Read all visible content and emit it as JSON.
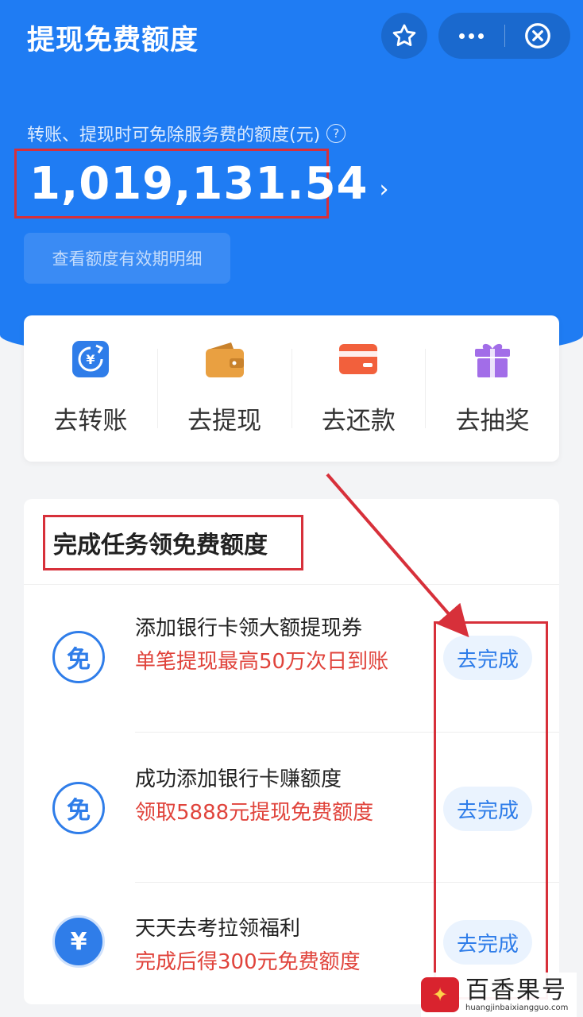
{
  "header": {
    "title": "提现免费额度"
  },
  "quota": {
    "label": "转账、提现时可免除服务费的额度(元)",
    "help": "?",
    "amount": "1,019,131.54",
    "arrow": "›",
    "validity_button": "查看额度有效期明细"
  },
  "actions": [
    {
      "label": "去转账",
      "icon": "transfer-icon",
      "color": "#2f7de9"
    },
    {
      "label": "去提现",
      "icon": "wallet-icon",
      "color": "#e9a041"
    },
    {
      "label": "去还款",
      "icon": "card-icon",
      "color": "#f2603c"
    },
    {
      "label": "去抽奖",
      "icon": "gift-icon",
      "color": "#a26de8"
    }
  ],
  "tasks": {
    "title": "完成任务领免费额度",
    "items": [
      {
        "icon": "免",
        "title": "添加银行卡领大额提现券",
        "desc": "单笔提现最高50万次日到账",
        "button": "去完成"
      },
      {
        "icon": "免",
        "title": "成功添加银行卡赚额度",
        "desc": "领取5888元提现免费额度",
        "button": "去完成"
      },
      {
        "icon": "¥",
        "title": "天天去考拉领福利",
        "desc": "完成后得300元免费额度",
        "button": "去完成"
      }
    ]
  },
  "watermark": {
    "name": "百香果号",
    "url": "huangjinbaixiangguo.com"
  },
  "colors": {
    "primary": "#1f7cf3",
    "accent_red": "#e0433b",
    "annotation_red": "#d7303a"
  }
}
